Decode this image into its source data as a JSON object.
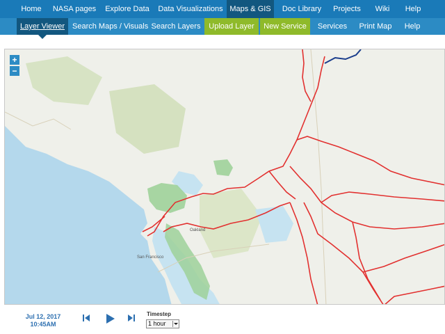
{
  "top_nav": {
    "items": [
      {
        "label": "Home"
      },
      {
        "label": "NASA pages"
      },
      {
        "label": "Explore Data"
      },
      {
        "label": "Data Visualizations"
      },
      {
        "label": "Maps & GIS",
        "active": true
      },
      {
        "label": "Doc Library"
      },
      {
        "label": "Projects"
      },
      {
        "label": "Wiki"
      },
      {
        "label": "Help"
      }
    ]
  },
  "sub_nav": {
    "items": [
      {
        "label": "Layer Viewer",
        "active": true
      },
      {
        "label": "Search Maps / Visuals"
      },
      {
        "label": "Search Layers"
      },
      {
        "label": "Upload Layer",
        "highlight": true
      },
      {
        "label": "New Service",
        "highlight": true
      },
      {
        "label": "Services"
      },
      {
        "label": "Print Map"
      },
      {
        "label": "Help"
      }
    ]
  },
  "map": {
    "zoom_in": "+",
    "zoom_out": "−",
    "labels": {
      "oakland": "Oakland",
      "san_francisco": "San Francisco"
    }
  },
  "timebar": {
    "date": "Jul 12, 2017",
    "time": "10:45AM",
    "timestep_label": "Timestep",
    "timestep_value": "1 hour"
  },
  "colors": {
    "top_nav": "#1a7ab8",
    "sub_nav": "#2c8bc4",
    "active": "#12577f",
    "highlight": "#8fba2a",
    "layer_line": "#e2302f",
    "water": "#b4d8ec",
    "wetland": "#9ed19a"
  },
  "icons": [
    "previous-icon",
    "play-icon",
    "next-icon",
    "dropdown-arrow-icon"
  ]
}
